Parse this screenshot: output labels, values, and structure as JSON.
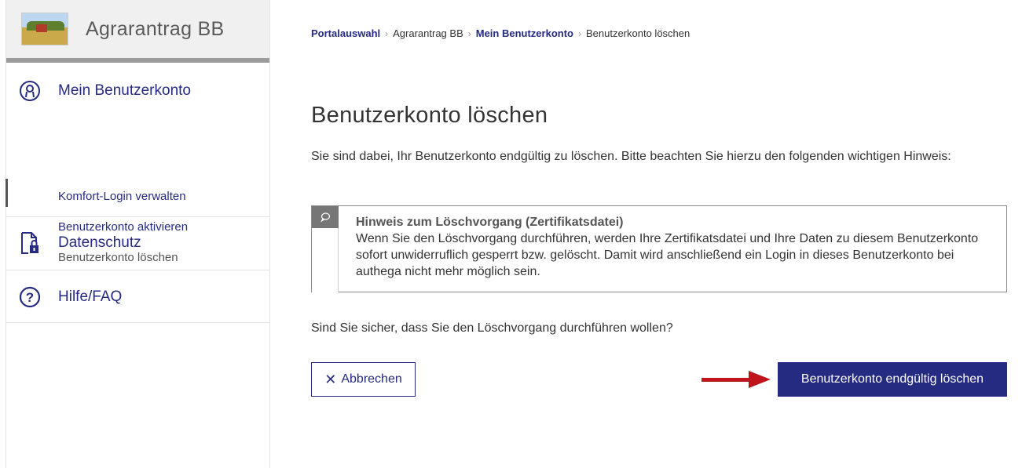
{
  "sidebar": {
    "app_title": "Agrarantrag  BB",
    "sections": [
      {
        "label": "Mein Benutzerkonto",
        "icon": "user-circle-icon"
      },
      {
        "label": "Datenschutz",
        "icon": "document-lock-icon"
      },
      {
        "label": "Hilfe/FAQ",
        "icon": "question-circle-icon"
      }
    ],
    "subitems": [
      {
        "label": "Komfort-Login verwalten"
      },
      {
        "label": "Benutzerkonto aktivieren"
      },
      {
        "label": "Benutzerkonto löschen",
        "active": true
      }
    ]
  },
  "breadcrumb": [
    "Portalauswahl",
    "Agrarantrag BB",
    "Mein Benutzerkonto",
    "Benutzerkonto löschen"
  ],
  "page": {
    "title": "Benutzerkonto löschen",
    "intro": "Sie sind dabei, Ihr Benutzerkonto endgültig zu löschen. Bitte beachten Sie hierzu den folgenden wichtigen Hinweis:",
    "notice_heading": "Hinweis zum Löschvorgang (Zertifikatsdatei)",
    "notice_text": "Wenn Sie den Löschvorgang durchführen, werden Ihre Zertifikatsdatei und Ihre Daten zu diesem Benutzerkonto sofort unwiderruflich gesperrt bzw. gelöscht. Damit wird anschließend ein Login in dieses Benutzerkonto bei authega nicht mehr möglich sein.",
    "question": "Sind Sie sicher, dass Sie den Löschvorgang durchführen wollen?",
    "cancel_label": "Abbrechen",
    "delete_label": "Benutzerkonto endgültig löschen"
  },
  "colors": {
    "brand": "#262b82",
    "annotation_arrow": "#c0141c"
  }
}
